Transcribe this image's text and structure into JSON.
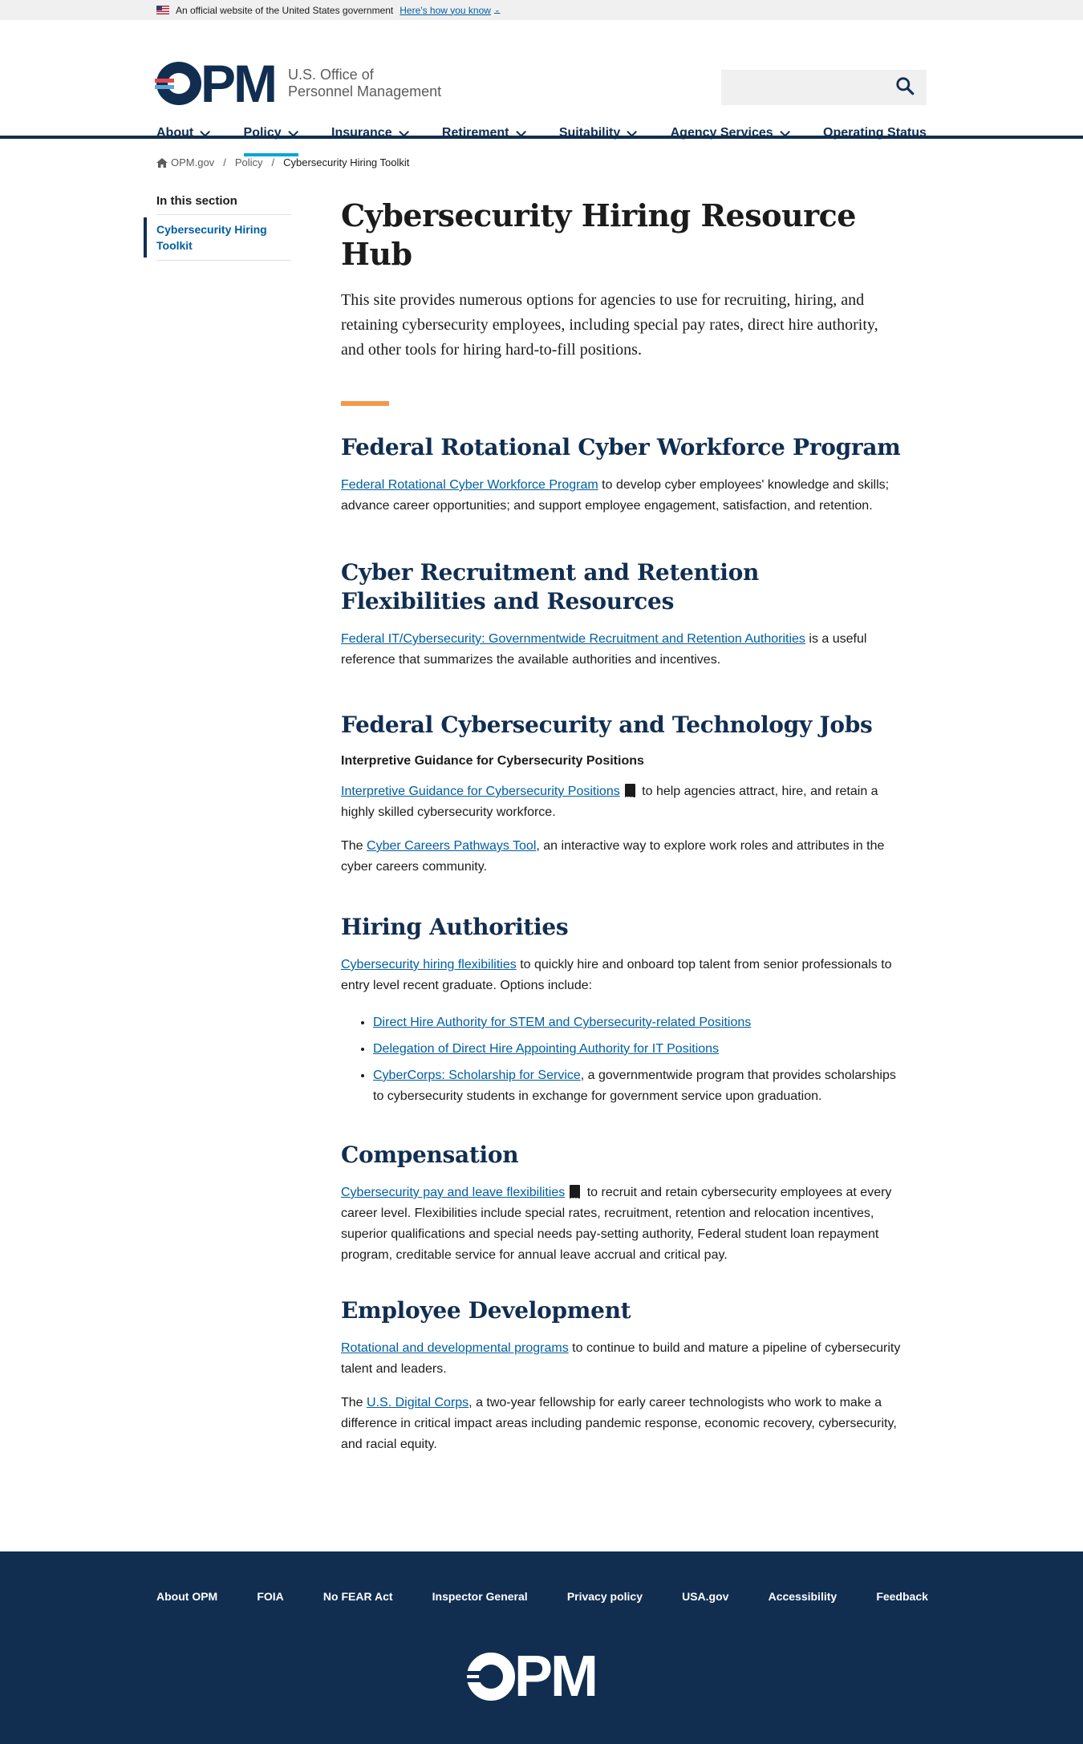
{
  "banner": {
    "text": "An official website of the United States government",
    "link": "Here's how you know"
  },
  "header": {
    "logo_letters": "PM",
    "logo_line1": "U.S. Office of",
    "logo_line2": "Personnel Management",
    "search_placeholder": ""
  },
  "nav": {
    "items": [
      {
        "label": "About"
      },
      {
        "label": "Policy"
      },
      {
        "label": "Insurance"
      },
      {
        "label": "Retirement"
      },
      {
        "label": "Suitability"
      },
      {
        "label": "Agency Services"
      },
      {
        "label": "Operating Status"
      }
    ]
  },
  "breadcrumb": {
    "home": "OPM.gov",
    "level1": "Policy",
    "current": "Cybersecurity Hiring Toolkit"
  },
  "sidenav": {
    "title": "In this section",
    "item": "Cybersecurity Hiring Toolkit"
  },
  "page": {
    "title": "Cybersecurity Hiring Resource Hub",
    "intro": "This site provides numerous options for agencies to use for recruiting, hiring, and retaining cybersecurity employees, including special pay rates, direct hire authority, and other tools for hiring hard-to-fill positions."
  },
  "sections": {
    "rotational": {
      "heading": "Federal Rotational Cyber Workforce Program",
      "link": "Federal Rotational Cyber Workforce Program",
      "text": " to develop cyber employees' knowledge and skills; advance career opportunities; and support employee engagement, satisfaction, and retention."
    },
    "recruitment": {
      "heading": "Cyber Recruitment and Retention Flexibilities and Resources",
      "link": "Federal IT/Cybersecurity:  Governmentwide Recruitment and Retention Authorities",
      "text": " is a useful reference that summarizes the available authorities and incentives."
    },
    "jobs": {
      "heading": "Federal Cybersecurity and Technology Jobs",
      "subheading": "Interpretive Guidance for Cybersecurity Positions",
      "p1_link": "Interpretive Guidance for Cybersecurity Positions",
      "p1_text": " to help agencies attract, hire, and retain a highly skilled cybersecurity workforce.",
      "p2_pre": "The ",
      "p2_link": "Cyber Careers Pathways Tool",
      "p2_text": ", an interactive way to explore work roles and attributes in the cyber careers community."
    },
    "hiring": {
      "heading": "Hiring Authorities",
      "link": "Cybersecurity hiring flexibilities",
      "text": " to quickly hire and onboard top talent from senior professionals to entry level recent graduate. Options include:",
      "list": [
        {
          "link": "Direct Hire Authority for STEM and Cybersecurity-related Positions",
          "text": ""
        },
        {
          "link": "Delegation of Direct Hire Appointing Authority for IT Positions",
          "text": ""
        },
        {
          "link": "CyberCorps: Scholarship for Service",
          "text": ", a governmentwide program that provides scholarships to cybersecurity students in exchange for government service upon graduation."
        }
      ]
    },
    "compensation": {
      "heading": "Compensation",
      "link": "Cybersecurity pay and leave flexibilities",
      "text": " to recruit and retain cybersecurity employees at every career level. Flexibilities include special rates, recruitment, retention and relocation incentives, superior qualifications and special needs pay-setting authority, Federal student loan repayment program, creditable service for annual leave accrual and critical pay."
    },
    "development": {
      "heading": "Employee Development",
      "p1_link": "Rotational and developmental programs",
      "p1_text": " to continue to build and mature a pipeline of cybersecurity talent and leaders.",
      "p2_pre": "The ",
      "p2_link": "U.S. Digital Corps",
      "p2_text": ", a two-year fellowship for early career technologists who work to make a difference in critical impact areas including pandemic response, economic recovery, cybersecurity, and racial equity."
    }
  },
  "footer": {
    "links": [
      "About OPM",
      "FOIA",
      "No FEAR Act",
      "Inspector General",
      "Privacy policy",
      "USA.gov",
      "Accessibility",
      "Feedback"
    ],
    "logo_letters": "PM"
  },
  "colors": {
    "navy": "#112e51",
    "link": "#005ea2",
    "accent_orange": "#f2994a",
    "active_tab": "#00a6d2"
  },
  "icons": [
    "us-flag-icon",
    "chevron-down-icon",
    "search-icon",
    "home-icon",
    "pdf-icon"
  ]
}
